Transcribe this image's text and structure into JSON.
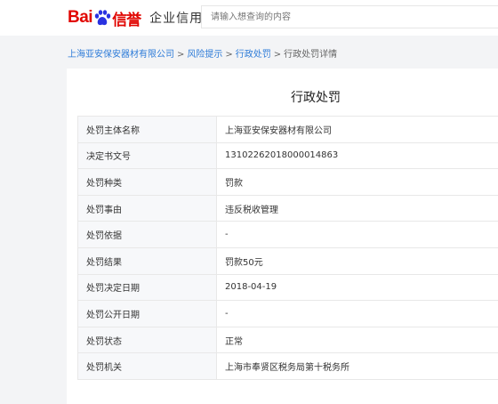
{
  "header": {
    "logo_bai": "Bai",
    "logo_du": "信誉",
    "logo_sub": "企业信用",
    "search_placeholder": "请输入想查询的内容"
  },
  "breadcrumb": {
    "items": [
      "上海亚安保安器材有限公司",
      "风险提示",
      "行政处罚"
    ],
    "current": "行政处罚详情",
    "separator": ">"
  },
  "page": {
    "title": "行政处罚"
  },
  "details": [
    {
      "key": "处罚主体名称",
      "value": "上海亚安保安器材有限公司"
    },
    {
      "key": "决定书文号",
      "value": "13102262018000014863"
    },
    {
      "key": "处罚种类",
      "value": "罚款"
    },
    {
      "key": "处罚事由",
      "value": "违反税收管理"
    },
    {
      "key": "处罚依据",
      "value": "-"
    },
    {
      "key": "处罚结果",
      "value": "罚款50元"
    },
    {
      "key": "处罚决定日期",
      "value": "2018-04-19"
    },
    {
      "key": "处罚公开日期",
      "value": "-"
    },
    {
      "key": "处罚状态",
      "value": "正常"
    },
    {
      "key": "处罚机关",
      "value": "上海市奉贤区税务局第十税务所"
    }
  ],
  "colors": {
    "brand_red": "#e10601",
    "paw_blue": "#2932e1",
    "link_blue": "#2d7bd8"
  }
}
